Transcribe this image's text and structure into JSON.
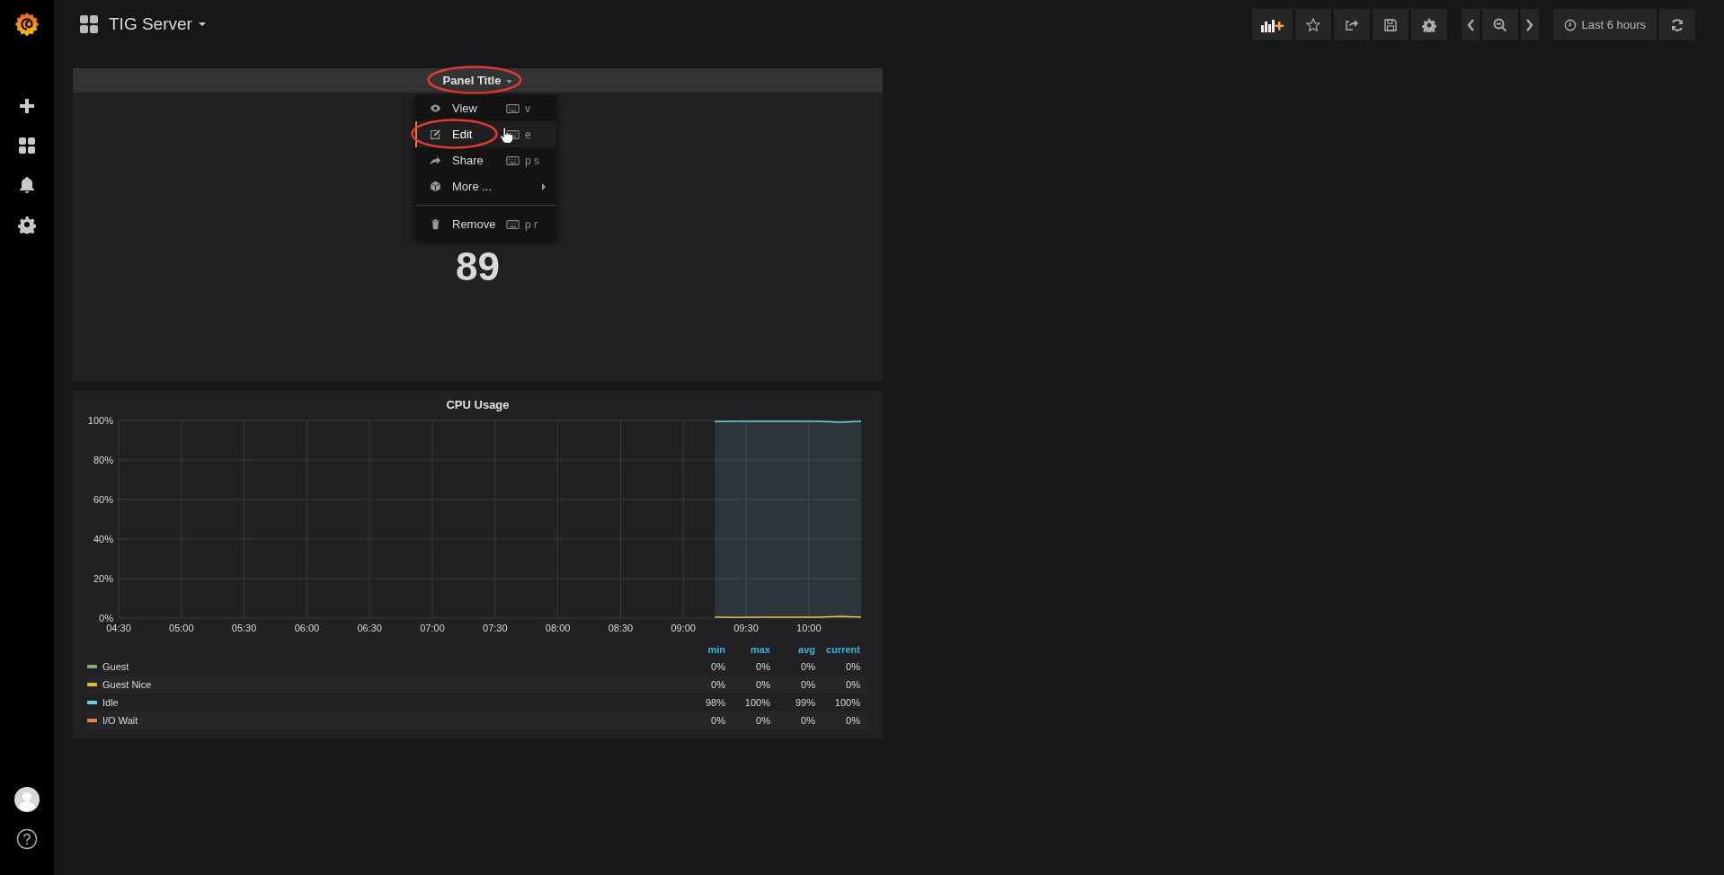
{
  "sidebar": {
    "items": [
      {
        "kind": "create"
      },
      {
        "kind": "dashboards"
      },
      {
        "kind": "alerting"
      },
      {
        "kind": "configuration"
      }
    ],
    "bottom": [
      {
        "kind": "profile"
      },
      {
        "kind": "help"
      }
    ]
  },
  "header": {
    "title": "TIG Server",
    "toolbar": [
      {
        "kind": "add-panel"
      },
      {
        "kind": "star"
      },
      {
        "kind": "share"
      },
      {
        "kind": "save"
      },
      {
        "kind": "settings"
      }
    ],
    "time_nav": [
      {
        "kind": "back"
      },
      {
        "kind": "zoom-out"
      },
      {
        "kind": "forward"
      }
    ],
    "time_picker": "Last 6 hours",
    "refresh": {
      "kind": "refresh"
    }
  },
  "panel": {
    "title": "Panel Title",
    "circled": true,
    "value": "89",
    "menu": [
      {
        "kind": "view",
        "label": "View",
        "shortcut": "v",
        "selected": false,
        "circled": false
      },
      {
        "kind": "edit",
        "label": "Edit",
        "shortcut": "e",
        "selected": true,
        "circled": true
      },
      {
        "kind": "share",
        "label": "Share",
        "shortcut": "p s",
        "selected": false,
        "circled": false
      },
      {
        "kind": "more",
        "label": "More ...",
        "selected": false,
        "circled": false
      },
      {
        "kind": "divider"
      },
      {
        "kind": "remove",
        "label": "Remove",
        "shortcut": "p r",
        "selected": false,
        "circled": false
      }
    ]
  },
  "graph": {
    "title": "CPU Usage",
    "chart_data": {
      "type": "area",
      "grid": true,
      "x": [
        555,
        565,
        575,
        585,
        595,
        605,
        615,
        625
      ],
      "xlim": [
        270,
        625
      ],
      "ylim": [
        0,
        100
      ],
      "xticks": [
        {
          "value": 270,
          "label": "04:30"
        },
        {
          "value": 300,
          "label": "05:00"
        },
        {
          "value": 330,
          "label": "05:30"
        },
        {
          "value": 360,
          "label": "06:00"
        },
        {
          "value": 390,
          "label": "06:30"
        },
        {
          "value": 420,
          "label": "07:00"
        },
        {
          "value": 450,
          "label": "07:30"
        },
        {
          "value": 480,
          "label": "08:00"
        },
        {
          "value": 510,
          "label": "08:30"
        },
        {
          "value": 540,
          "label": "09:00"
        },
        {
          "value": 570,
          "label": "09:30"
        },
        {
          "value": 600,
          "label": "10:00"
        }
      ],
      "yticks": [
        {
          "value": 0,
          "label": "0%"
        },
        {
          "value": 20,
          "label": "20%"
        },
        {
          "value": 40,
          "label": "40%"
        },
        {
          "value": 60,
          "label": "60%"
        },
        {
          "value": 80,
          "label": "80%"
        },
        {
          "value": 100,
          "label": "100%"
        }
      ],
      "series": [
        {
          "name": "Guest",
          "color": "#7eb26d",
          "values": [
            null,
            null,
            null,
            null,
            null,
            null,
            null,
            null
          ]
        },
        {
          "name": "Guest Nice",
          "color": "#eab839",
          "values": [
            0.4,
            0.3,
            0.4,
            0.5,
            0.4,
            0.4,
            0.9,
            0.4
          ]
        },
        {
          "name": "Idle",
          "color": "#6ed0e0",
          "values": [
            99.4,
            99.6,
            99.5,
            99.6,
            99.6,
            99.6,
            99.1,
            99.6
          ]
        },
        {
          "name": "I/O Wait",
          "color": "#ef843c",
          "values": [
            null,
            null,
            null,
            null,
            null,
            null,
            null,
            null
          ]
        }
      ]
    },
    "legend": {
      "columns": [
        "min",
        "max",
        "avg",
        "current"
      ],
      "rows": [
        {
          "values": [
            "0%",
            "0%",
            "0%",
            "0%"
          ]
        },
        {
          "values": [
            "0%",
            "0%",
            "0%",
            "0%"
          ]
        },
        {
          "values": [
            "98%",
            "100%",
            "99%",
            "100%"
          ]
        },
        {
          "values": [
            "0%",
            "0%",
            "0%",
            "0%"
          ]
        }
      ]
    }
  }
}
